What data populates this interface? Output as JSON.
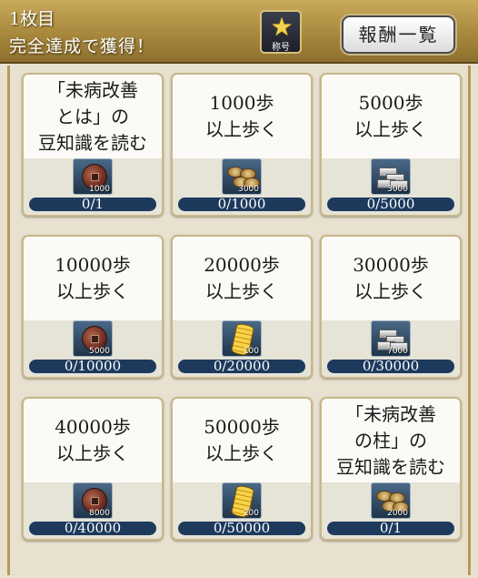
{
  "header": {
    "sheet": "1枚目",
    "reward_text": "完全達成で獲得！",
    "title_badge_label": "称号",
    "title_badge_icon": "star-icon",
    "reward_list_button": "報酬一覧"
  },
  "colors": {
    "header_gold": "#b0903f",
    "progress_bar": "#1d3a5d",
    "card_bg": "#fbfaf6",
    "star": "#f4d14c"
  },
  "missions": [
    {
      "lines": [
        "「未病改善",
        "とは」の",
        "豆知識を読む"
      ],
      "item": "coin-icon",
      "qty": "1000",
      "progress": "0/1"
    },
    {
      "lines": [
        "1000歩",
        "以上歩く"
      ],
      "item": "lumber-icon",
      "qty": "3000",
      "progress": "0/1000"
    },
    {
      "lines": [
        "5000歩",
        "以上歩く"
      ],
      "item": "stone-icon",
      "qty": "3000",
      "progress": "0/5000"
    },
    {
      "lines": [
        "10000歩",
        "以上歩く"
      ],
      "item": "coin-icon",
      "qty": "5000",
      "progress": "0/10000"
    },
    {
      "lines": [
        "20000歩",
        "以上歩く"
      ],
      "item": "gold-icon",
      "qty": "100",
      "progress": "0/20000"
    },
    {
      "lines": [
        "30000歩",
        "以上歩く"
      ],
      "item": "stone-icon",
      "qty": "7000",
      "progress": "0/30000"
    },
    {
      "lines": [
        "40000歩",
        "以上歩く"
      ],
      "item": "coin-icon",
      "qty": "8000",
      "progress": "0/40000"
    },
    {
      "lines": [
        "50000歩",
        "以上歩く"
      ],
      "item": "gold-icon",
      "qty": "200",
      "progress": "0/50000"
    },
    {
      "lines": [
        "「未病改善",
        "の柱」の",
        "豆知識を読む"
      ],
      "item": "lumber-icon",
      "qty": "2000",
      "progress": "0/1"
    }
  ]
}
